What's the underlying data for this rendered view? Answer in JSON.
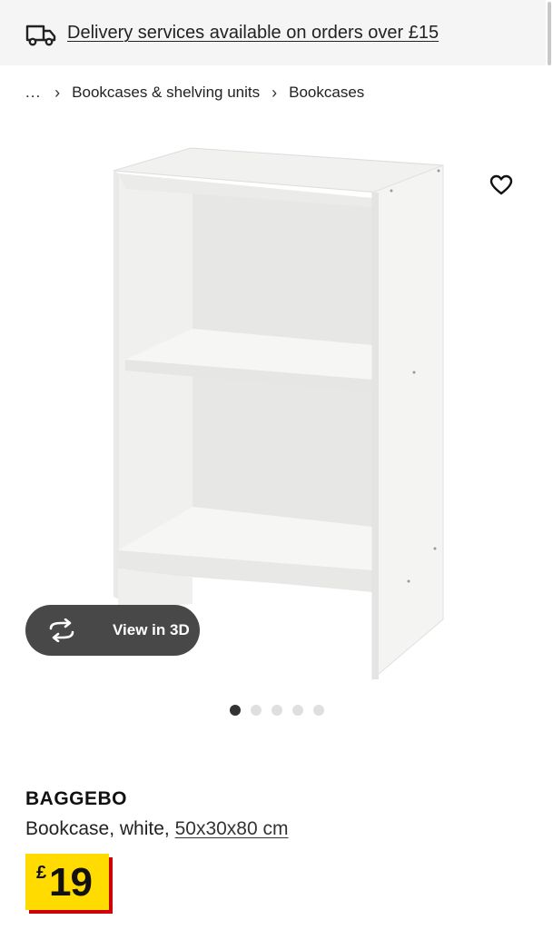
{
  "banner": {
    "icon": "delivery-truck-icon",
    "text": "Delivery services available on orders over £15"
  },
  "breadcrumb": {
    "ellipsis": "...",
    "separator_icon": "chevron-right-icon",
    "items": [
      {
        "label": "Bookcases & shelving units"
      },
      {
        "label": "Bookcases"
      }
    ]
  },
  "gallery": {
    "favourite_icon": "heart-icon",
    "view3d": {
      "icon": "rotate-3d-icon",
      "label": "View in 3D"
    },
    "dots": {
      "count": 5,
      "active_index": 0
    }
  },
  "product": {
    "name": "BAGGEBO",
    "description": "Bookcase, white, ",
    "measurements": "50x30x80 cm"
  },
  "price": {
    "currency": "£",
    "value": "19",
    "colors": {
      "background": "#ffdb00",
      "shadow": "#cc0008"
    }
  }
}
